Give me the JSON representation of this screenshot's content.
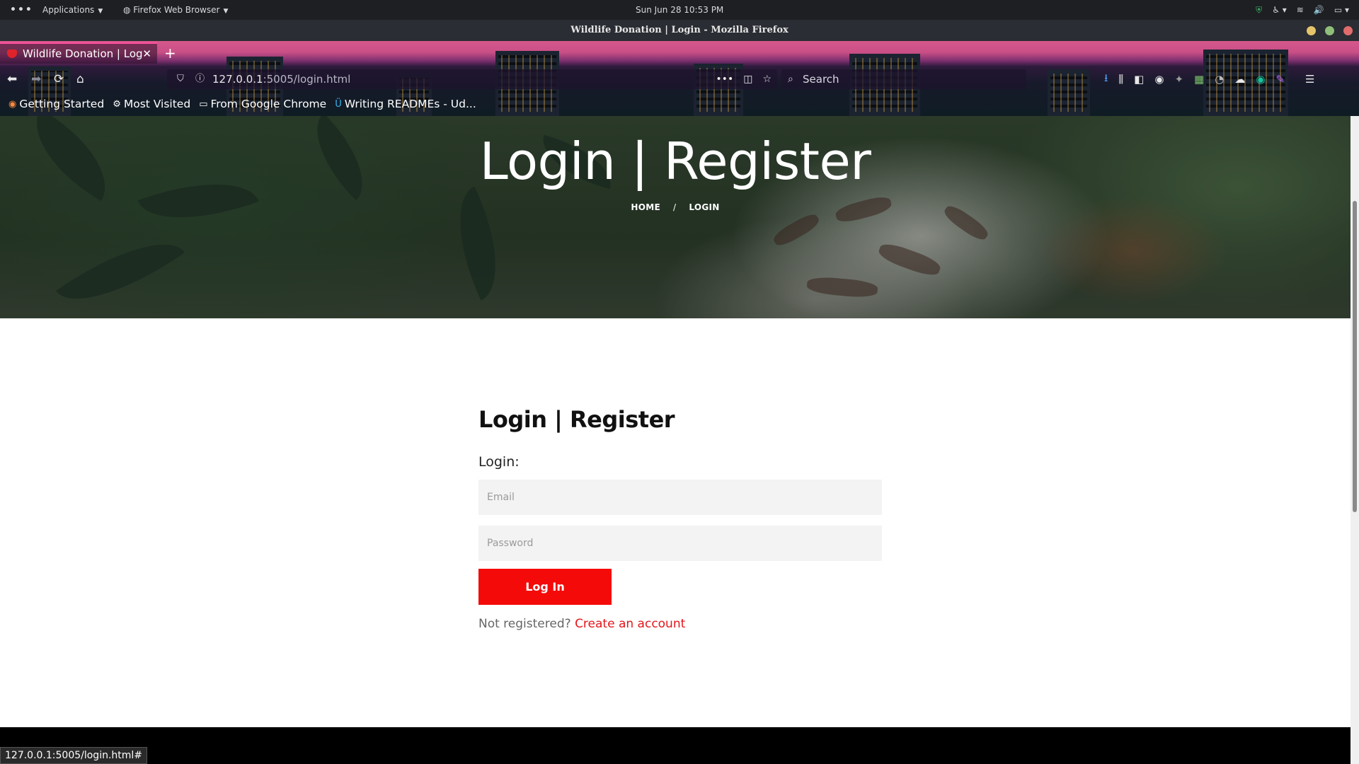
{
  "panel": {
    "apps_label": "Applications",
    "app_label": "Firefox Web Browser",
    "clock": "Sun Jun 28  10:53 PM"
  },
  "window": {
    "title": "Wildlife Donation | Login - Mozilla Firefox"
  },
  "tab": {
    "title": "Wildlife Donation | Log"
  },
  "url": {
    "host": "127.0.0.1",
    "rest": ":5005/login.html"
  },
  "search": {
    "placeholder": "Search"
  },
  "bookmarks": [
    {
      "label": "Getting Started"
    },
    {
      "label": "Most Visited"
    },
    {
      "label": "From Google Chrome"
    },
    {
      "label": "Writing READMEs - Ud..."
    }
  ],
  "hero": {
    "title": "Login | Register",
    "crumb_home": "HOME",
    "crumb_sep": "/",
    "crumb_current": "LOGIN"
  },
  "form": {
    "title": "Login | Register",
    "section_label": "Login:",
    "email_placeholder": "Email",
    "password_placeholder": "Password",
    "submit_label": "Log In",
    "register_prompt": "Not registered?",
    "register_link": "Create an account"
  },
  "status_bar": "127.0.0.1:5005/login.html#",
  "colors": {
    "accent": "#f50a0a",
    "link": "#e3161b",
    "tab_highlight": "#ff4fa0"
  }
}
